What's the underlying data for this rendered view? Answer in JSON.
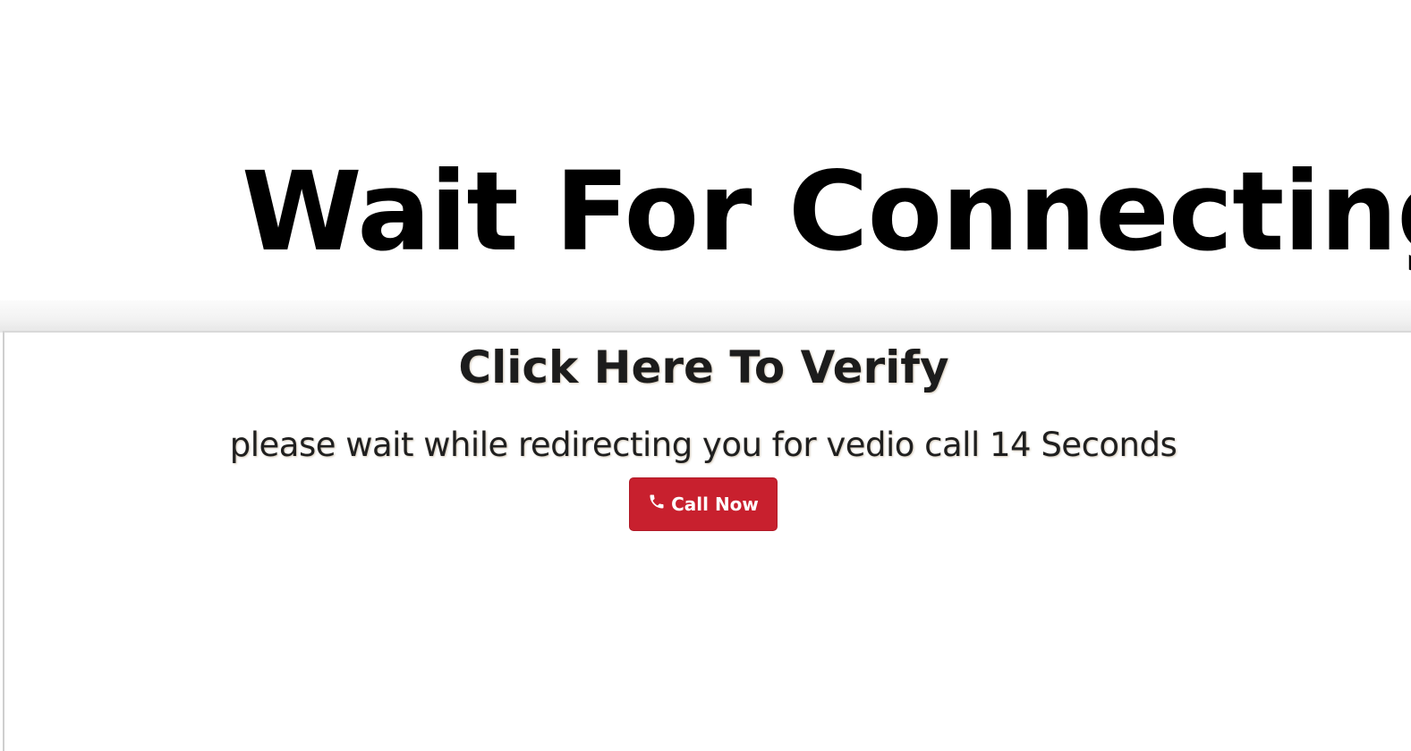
{
  "headline": "Wait For Connecting call",
  "panel": {
    "title": "Click Here To Verify",
    "redirect_text": "please wait while redirecting you for vedio call 14 Seconds",
    "call_button": {
      "label": "Call Now",
      "icon": "phone-icon",
      "color": "#c8202e"
    }
  }
}
